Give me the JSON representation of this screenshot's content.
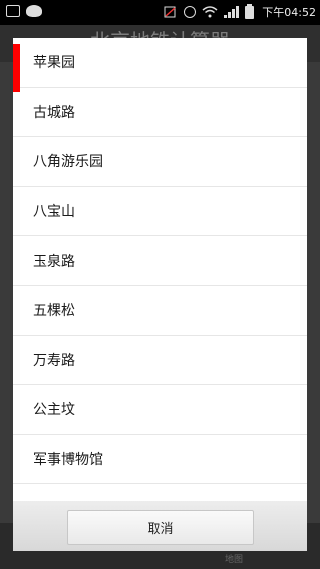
{
  "status_bar": {
    "time": "下午04:52",
    "icons": [
      "image-icon",
      "cat-icon",
      "sim-error-icon",
      "alarm-icon",
      "wifi-icon",
      "signal-icon",
      "battery-icon"
    ]
  },
  "background_app": {
    "title": "北京地铁计算器",
    "bottom_tab_right": "地图"
  },
  "dialog": {
    "items": [
      {
        "label": "苹果园",
        "selected": true
      },
      {
        "label": "古城路",
        "selected": false
      },
      {
        "label": "八角游乐园",
        "selected": false
      },
      {
        "label": "八宝山",
        "selected": false
      },
      {
        "label": "玉泉路",
        "selected": false
      },
      {
        "label": "五棵松",
        "selected": false
      },
      {
        "label": "万寿路",
        "selected": false
      },
      {
        "label": "公主坟",
        "selected": false
      },
      {
        "label": "军事博物馆",
        "selected": false
      }
    ],
    "cancel_label": "取消",
    "accent_color": "#ff0000"
  }
}
